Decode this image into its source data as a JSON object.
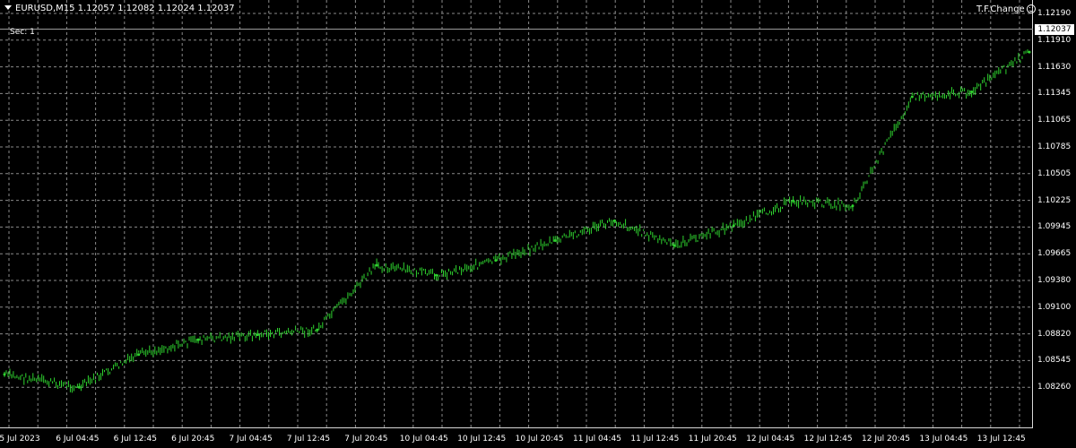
{
  "header": {
    "symbol_text": "EURUSD,M15  1.12057 1.12082 1.12024 1.12037",
    "sec_label": "Sec: 1",
    "tf_change_label": "T.F.Change"
  },
  "colors": {
    "background": "#000000",
    "bars": "#2fd32f",
    "grid": "#8a8a8a",
    "text": "#ffffff"
  },
  "price_axis": {
    "current_price": "1.12037",
    "labels": [
      "1.12190",
      "1.11910",
      "1.11630",
      "1.11345",
      "1.11065",
      "1.10785",
      "1.10505",
      "1.10225",
      "1.09945",
      "1.09665",
      "1.09380",
      "1.09100",
      "1.08820",
      "1.08545",
      "1.08260"
    ]
  },
  "time_axis": {
    "labels": [
      "5 Jul 2023",
      "6 Jul 04:45",
      "6 Jul 12:45",
      "6 Jul 20:45",
      "7 Jul 04:45",
      "7 Jul 12:45",
      "7 Jul 20:45",
      "10 Jul 04:45",
      "10 Jul 12:45",
      "10 Jul 20:45",
      "11 Jul 04:45",
      "11 Jul 12:45",
      "11 Jul 20:45",
      "12 Jul 04:45",
      "12 Jul 12:45",
      "12 Jul 20:45",
      "13 Jul 04:45",
      "13 Jul 12:45"
    ]
  },
  "chart_data": {
    "type": "line",
    "x": [
      "5 Jul 2023",
      "6 Jul 04:45",
      "6 Jul 12:45",
      "6 Jul 20:45",
      "7 Jul 04:45",
      "7 Jul 12:45",
      "7 Jul 20:45",
      "10 Jul 04:45",
      "10 Jul 12:45",
      "10 Jul 20:45",
      "11 Jul 04:45",
      "11 Jul 12:45",
      "11 Jul 20:45",
      "12 Jul 04:45",
      "12 Jul 12:45",
      "12 Jul 20:45",
      "13 Jul 04:45",
      "13 Jul 12:45"
    ],
    "series": [
      {
        "values": [
          1.0855,
          1.0842,
          1.0875,
          1.089,
          1.0895,
          1.09,
          1.0965,
          1.0955,
          1.097,
          1.099,
          1.101,
          1.0985,
          1.1005,
          1.103,
          1.1025,
          1.1135,
          1.114,
          1.118
        ]
      }
    ],
    "ylim": [
      1.0826,
      1.1219
    ],
    "grid": true
  }
}
